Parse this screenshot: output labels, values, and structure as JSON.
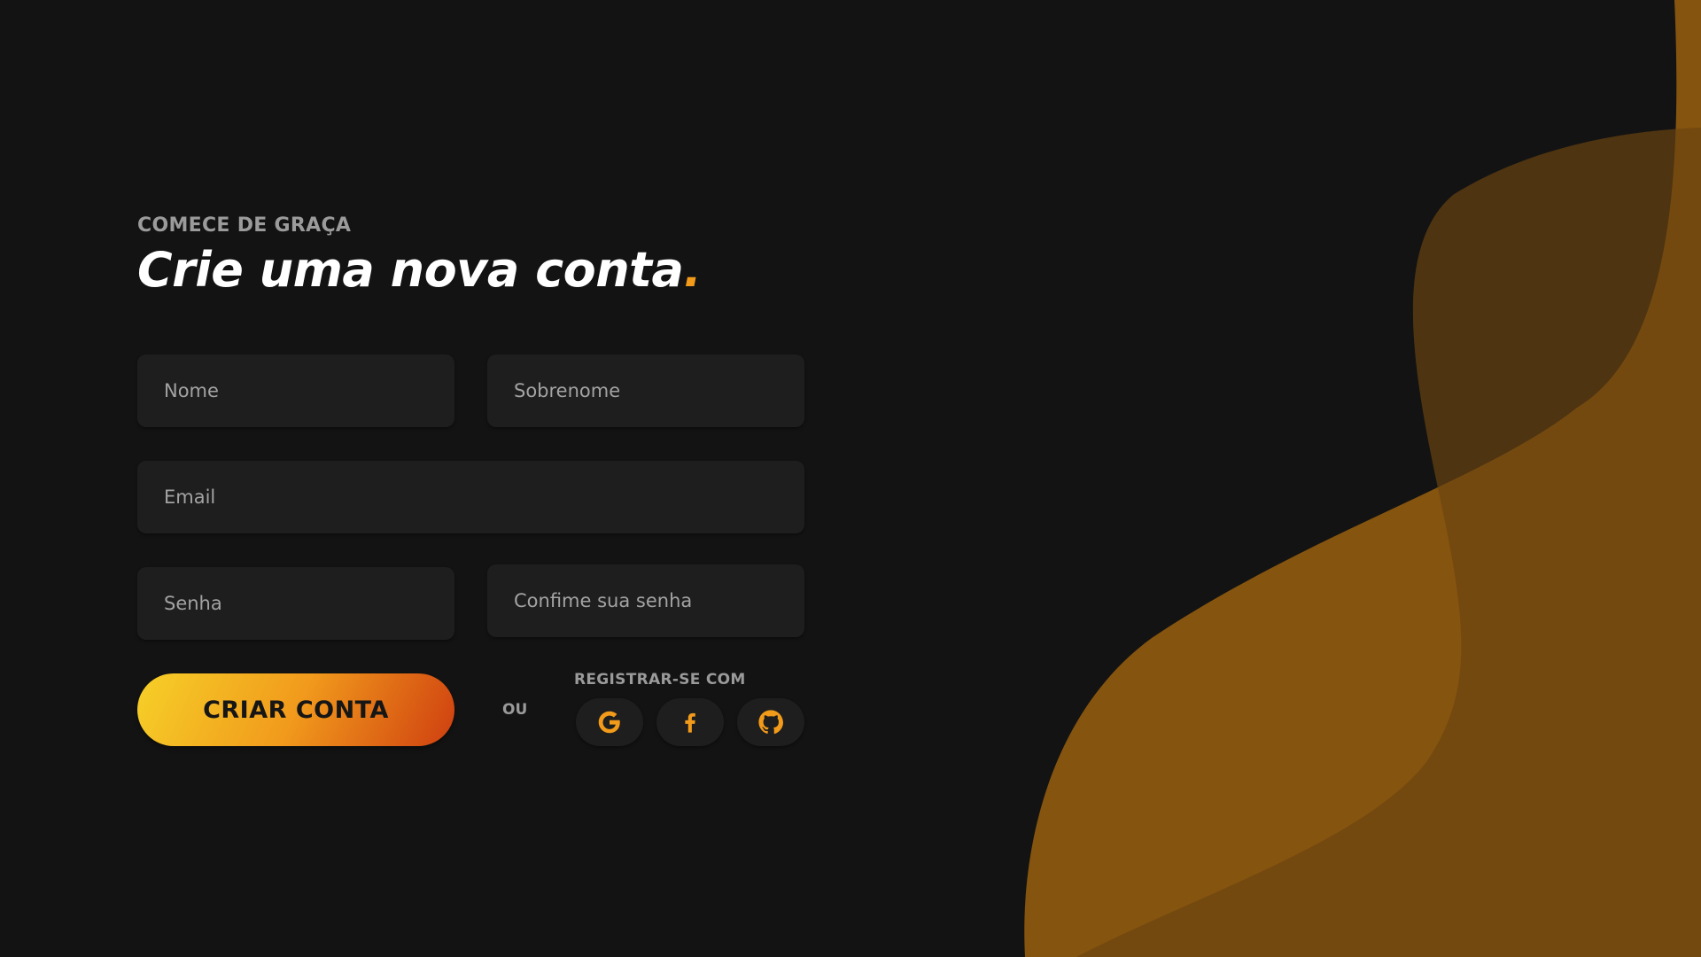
{
  "header": {
    "eyebrow": "COMECE DE GRAÇA",
    "title": "Crie uma nova conta",
    "title_dot": "."
  },
  "form": {
    "first_name": {
      "value": "",
      "placeholder": "Nome"
    },
    "last_name": {
      "value": "",
      "placeholder": "Sobrenome"
    },
    "email": {
      "value": "",
      "placeholder": "Email"
    },
    "password": {
      "value": "",
      "placeholder": "Senha"
    },
    "confirm_password": {
      "value": "",
      "placeholder": "Confime sua senha"
    }
  },
  "actions": {
    "create_label": "CRIAR CONTA",
    "or_label": "OU",
    "social_label": "REGISTRAR-SE COM",
    "social": [
      {
        "name": "google",
        "icon": "google-icon"
      },
      {
        "name": "facebook",
        "icon": "facebook-icon"
      },
      {
        "name": "github",
        "icon": "github-icon"
      }
    ]
  },
  "colors": {
    "background": "#131313",
    "field": "#1e1e1e",
    "accent": "#f29a1a",
    "button_gradient": [
      "#f6d028",
      "#f19a1c",
      "#cf3f10"
    ],
    "wave_dark": "#422c15",
    "wave_mid": "#85540f",
    "wave_light": "#a0660f"
  }
}
